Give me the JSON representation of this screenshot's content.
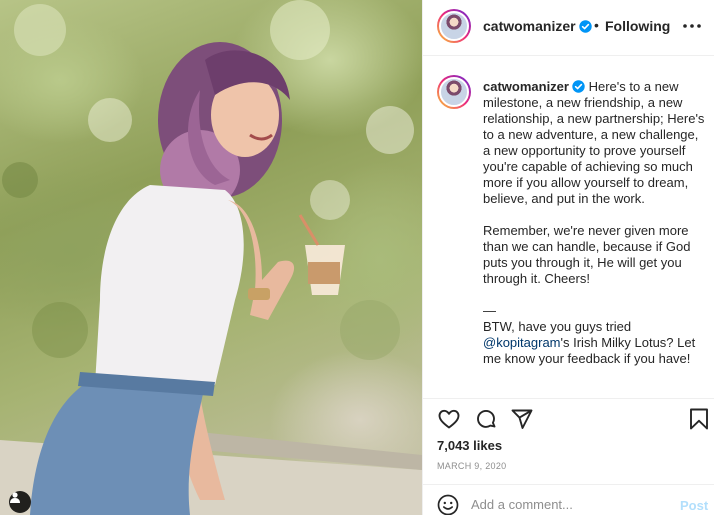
{
  "photo": {
    "user_tag_icon": "user-icon"
  },
  "header": {
    "username": "catwomanizer",
    "separator": "•",
    "follow_status": "Following",
    "verified_icon": "verified-badge-icon",
    "more_icon": "more-horizontal-icon"
  },
  "caption": {
    "username": "catwomanizer",
    "paragraph1": "Here's to a new milestone, a new friendship, a new relationship, a new partnership; Here's to a new adventure, a new challenge, a new opportunity to prove yourself you're capable of achieving so much more if you allow yourself to dream, believe, and put in the work.",
    "paragraph2": "Remember, we're never given more than we can handle, because if God puts you through it, He will get you through it. Cheers!",
    "dash": "—",
    "paragraph3_prefix": "BTW, have you guys tried",
    "mention": "@kopitagram",
    "paragraph3_suffix": "'s Irish Milky Lotus? Let me know your feedback if you have!"
  },
  "actions": {
    "like_icon": "heart-icon",
    "comment_icon": "comment-icon",
    "share_icon": "paper-plane-icon",
    "save_icon": "bookmark-icon"
  },
  "stats": {
    "likes": "7,043 likes",
    "date": "MARCH 9, 2020"
  },
  "comment": {
    "emoji_icon": "smiley-icon",
    "placeholder": "Add a comment...",
    "post_label": "Post"
  },
  "colors": {
    "accent_disabled": "#b2dffc",
    "verified": "#0095f6",
    "text": "#262626",
    "muted": "#8e8e8e",
    "mention": "#00376b"
  }
}
